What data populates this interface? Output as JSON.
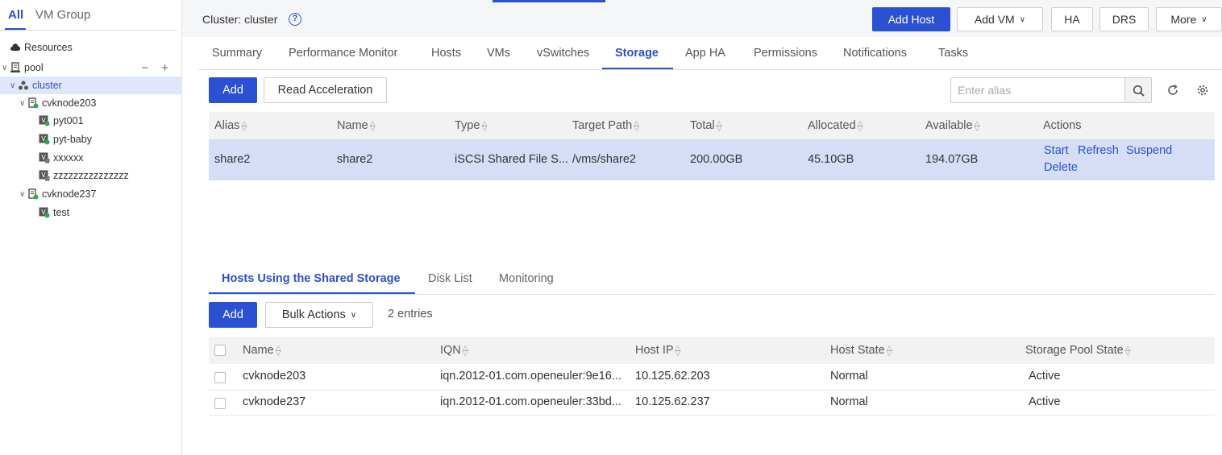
{
  "sidebar": {
    "tabs": {
      "all": "All",
      "vm_group": "VM Group"
    },
    "tree": {
      "resources": "Resources",
      "pool": "pool",
      "pool_actions": "− +",
      "cluster": "cluster",
      "host1": "cvknode203",
      "vm1": "pyt001",
      "vm2": "pyt-baby",
      "vm3": "xxxxxx",
      "vm4": "zzzzzzzzzzzzzzz",
      "host2": "cvknode237",
      "vm5": "test"
    }
  },
  "header": {
    "title": "Cluster: cluster",
    "help": "?",
    "buttons": {
      "add_host": "Add Host",
      "add_vm": "Add VM",
      "ha": "HA",
      "drs": "DRS",
      "more": "More"
    }
  },
  "tabs": [
    "Summary",
    "Performance Monitor",
    "Hosts",
    "VMs",
    "vSwitches",
    "Storage",
    "App HA",
    "Permissions",
    "Notifications",
    "Tasks"
  ],
  "storage": {
    "add_label": "Add",
    "read_accel_label": "Read Acceleration",
    "search_placeholder": "Enter alias",
    "columns": [
      "Alias",
      "Name",
      "Type",
      "Target Path",
      "Total",
      "Allocated",
      "Available",
      "Actions"
    ],
    "rows": [
      {
        "alias": "share2",
        "name": "share2",
        "type": "iSCSI Shared File S...",
        "target_path": "/vms/share2",
        "total": "200.00GB",
        "allocated": "45.10GB",
        "available": "194.07GB",
        "actions": {
          "start": "Start",
          "refresh": "Refresh",
          "suspend": "Suspend",
          "delete": "Delete"
        }
      }
    ]
  },
  "subtabs": [
    "Hosts Using the Shared Storage",
    "Disk List",
    "Monitoring"
  ],
  "hosts": {
    "add_label": "Add",
    "bulk_label": "Bulk Actions",
    "entries": "2 entries",
    "columns": [
      "Name",
      "IQN",
      "Host IP",
      "Host State",
      "Storage Pool State"
    ],
    "rows": [
      {
        "name": "cvknode203",
        "iqn": "iqn.2012-01.com.openeuler:9e16...",
        "ip": "10.125.62.203",
        "state": "Normal",
        "pool_state": "Active"
      },
      {
        "name": "cvknode237",
        "iqn": "iqn.2012-01.com.openeuler:33bd...",
        "ip": "10.125.62.237",
        "state": "Normal",
        "pool_state": "Active"
      }
    ]
  },
  "colors": {
    "accent": "#2b50d3",
    "selected_row": "#d6ddf7",
    "tree_selected": "#e1e7fa"
  }
}
